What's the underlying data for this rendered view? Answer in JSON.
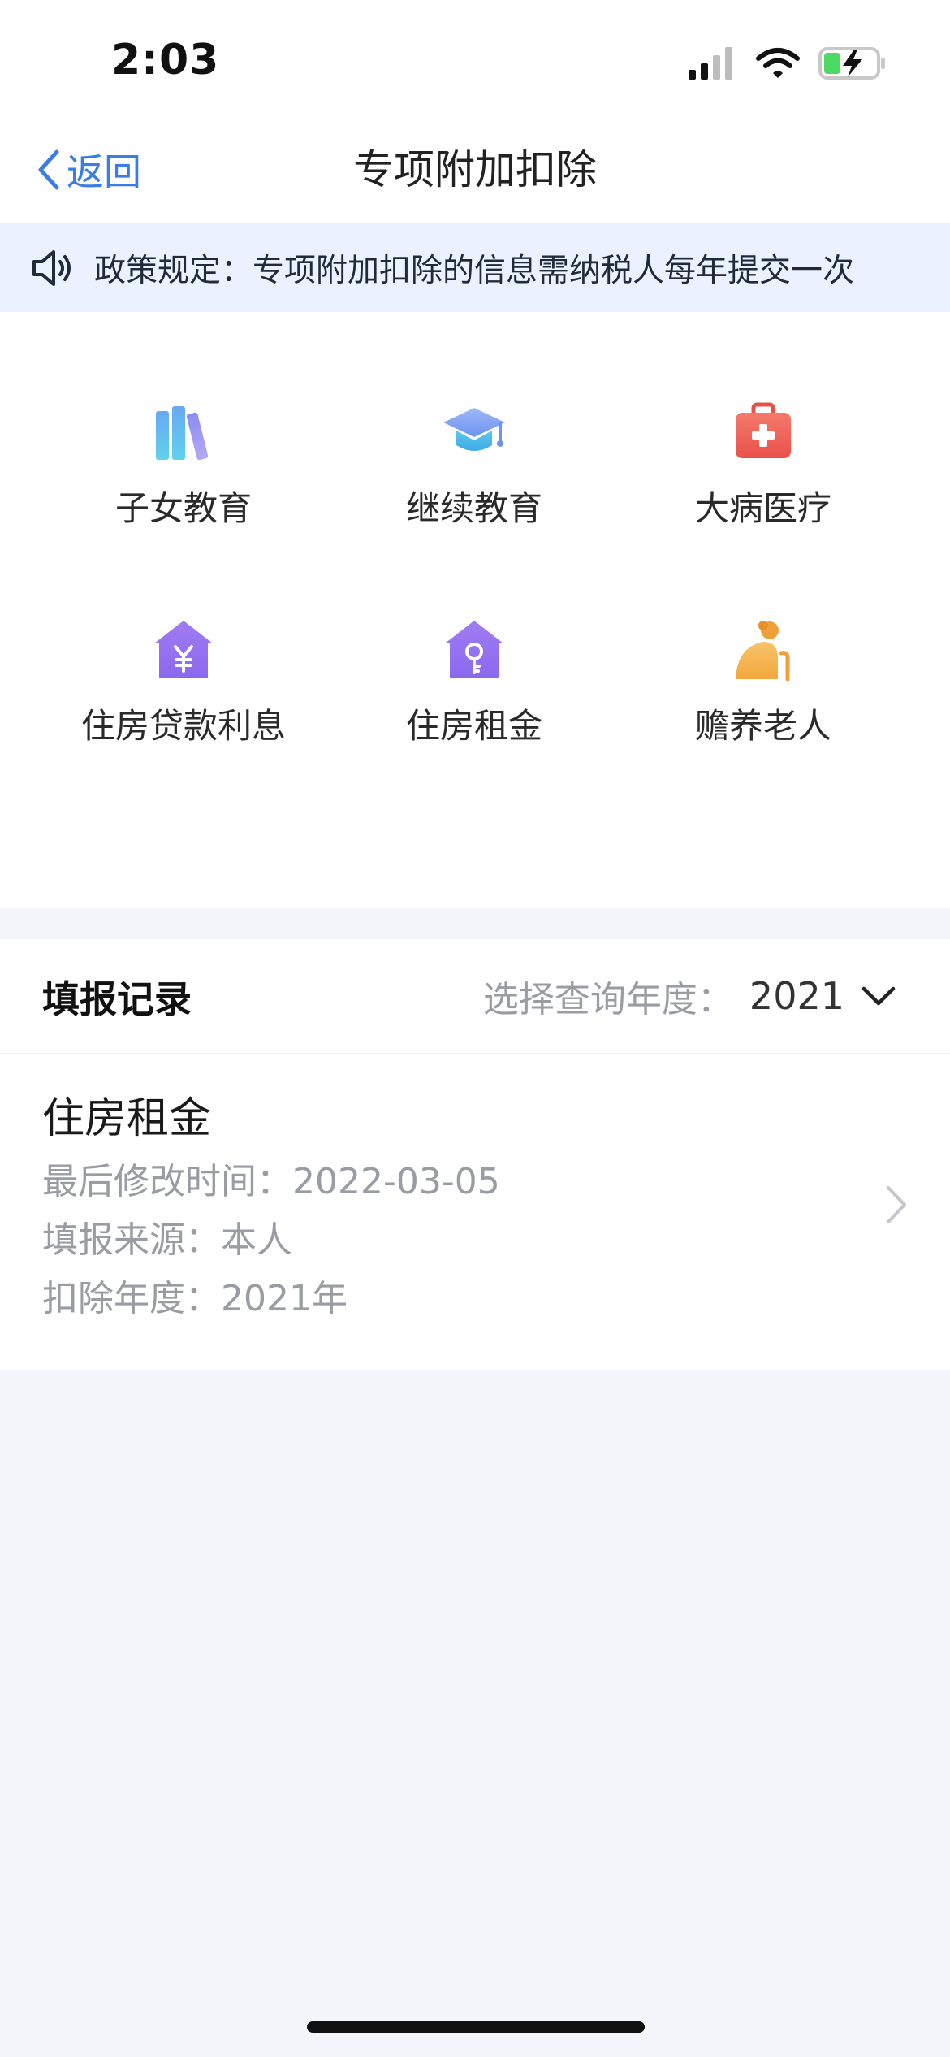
{
  "status": {
    "time": "2:03"
  },
  "nav": {
    "back_label": "返回",
    "title": "专项附加扣除"
  },
  "notice": {
    "text": "政策规定：专项附加扣除的信息需纳税人每年提交一次"
  },
  "categories": [
    {
      "label": "子女教育",
      "icon": "books-icon"
    },
    {
      "label": "继续教育",
      "icon": "graduation-cap-icon"
    },
    {
      "label": "大病医疗",
      "icon": "medical-kit-icon"
    },
    {
      "label": "住房贷款利息",
      "icon": "house-yen-icon"
    },
    {
      "label": "住房租金",
      "icon": "house-key-icon"
    },
    {
      "label": "赡养老人",
      "icon": "elderly-person-icon"
    }
  ],
  "records": {
    "title": "填报记录",
    "year_label": "选择查询年度：",
    "year_value": "2021",
    "items": [
      {
        "title": "住房租金",
        "lines": [
          "最后修改时间：2022-03-05",
          "填报来源：本人",
          "扣除年度：2021年"
        ]
      }
    ]
  },
  "colors": {
    "accent": "#3b7de4",
    "notice_bg": "#e9f2fe",
    "page_bg": "#f3f5fa",
    "battery": "#4cd964"
  }
}
